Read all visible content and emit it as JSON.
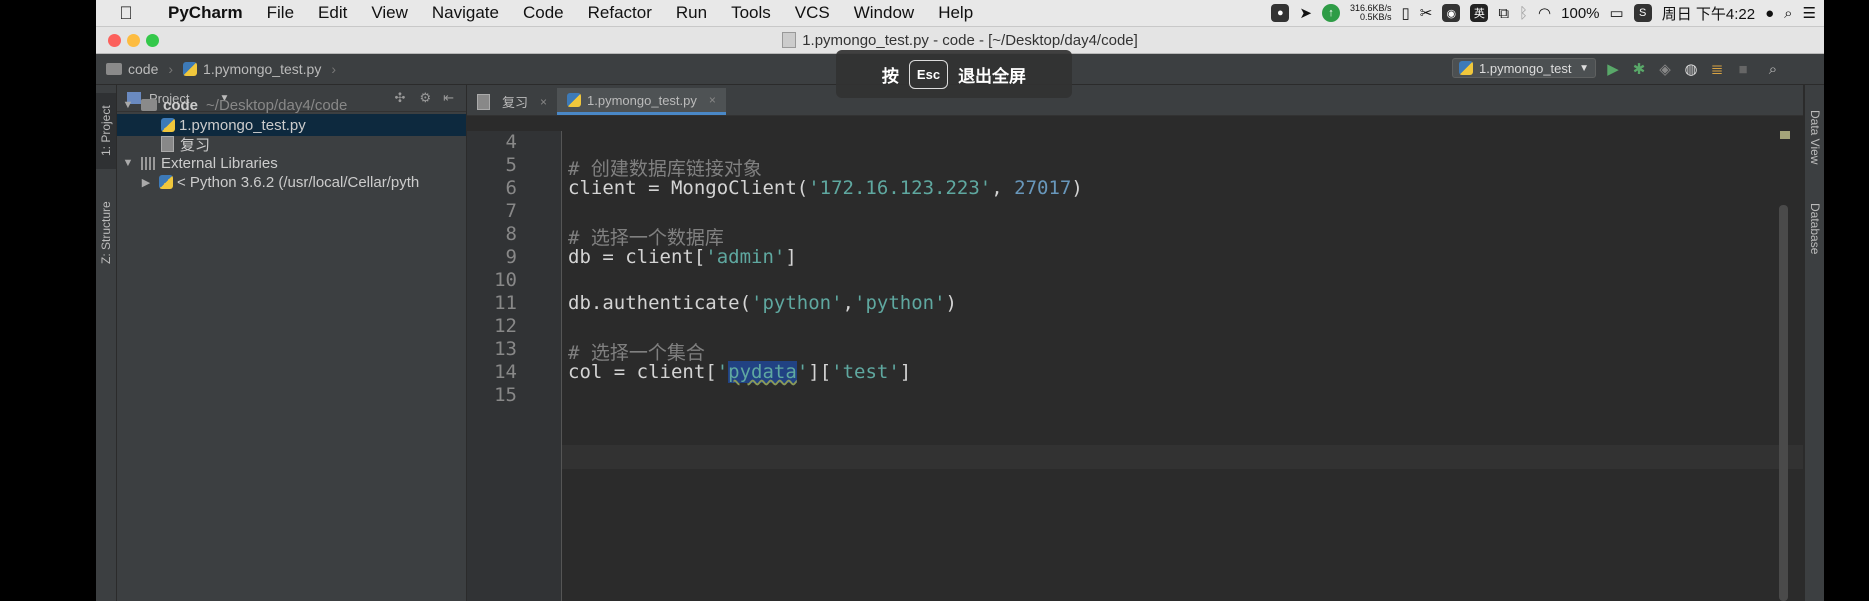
{
  "menubar": {
    "app": "PyCharm",
    "items": [
      "File",
      "Edit",
      "View",
      "Navigate",
      "Code",
      "Refactor",
      "Run",
      "Tools",
      "VCS",
      "Window",
      "Help"
    ],
    "net_up": "316.6KB/s",
    "net_down": "0.5KB/s",
    "ime": "英",
    "battery": "100%",
    "clock": "周日 下午4:22"
  },
  "window": {
    "title": "1.pymongo_test.py - code - [~/Desktop/day4/code]"
  },
  "navbar": {
    "crumb_folder": "code",
    "crumb_file": "1.pymongo_test.py",
    "run_config": "1.pymongo_test"
  },
  "overlay": {
    "prefix": "按",
    "key": "Esc",
    "suffix": "退出全屏"
  },
  "left_strip": {
    "project_tab": "1: Project",
    "structure_tab": "Z: Structure"
  },
  "project": {
    "header": "Project",
    "root_name": "code",
    "root_path": "~/Desktop/day4/code",
    "file1": "1.pymongo_test.py",
    "file2": "复习",
    "external": "External Libraries",
    "python": "< Python 3.6.2 (/usr/local/Cellar/pyth"
  },
  "tabs": {
    "tab1": "复习",
    "tab2": "1.pymongo_test.py"
  },
  "code": {
    "lines": [
      "4",
      "5",
      "6",
      "7",
      "8",
      "9",
      "10",
      "11",
      "12",
      "13",
      "14",
      "15"
    ],
    "l5": "# 创建数据库链接对象",
    "l6_a": "client = MongoClient(",
    "l6_b": "'172.16.123.223'",
    "l6_c": ", ",
    "l6_d": "27017",
    "l6_e": ")",
    "l8": "# 选择一个数据库",
    "l9_a": "db = client[",
    "l9_b": "'admin'",
    "l9_c": "]",
    "l11_a": "db.authenticate(",
    "l11_b": "'python'",
    "l11_c": ",",
    "l11_d": "'python'",
    "l11_e": ")",
    "l13": "# 选择一个集合",
    "l14_a": "col = client[",
    "l14_b": "'",
    "l14_c": "pydata",
    "l14_d": "'",
    "l14_e": "][",
    "l14_f": "'test'",
    "l14_g": "]"
  },
  "right_strip": {
    "dataview": "Data View",
    "database": "Database"
  }
}
